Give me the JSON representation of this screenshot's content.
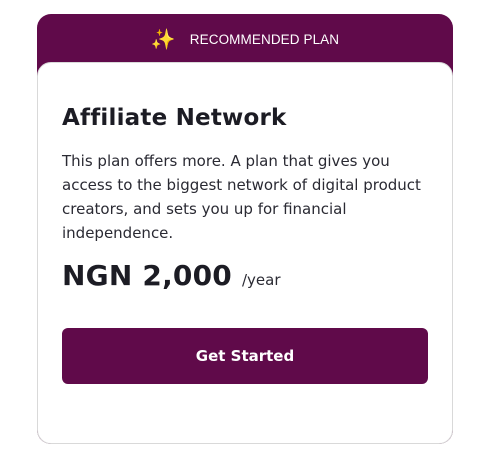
{
  "ribbon": {
    "icon": "sparkles-icon",
    "label": "RECOMMENDED PLAN"
  },
  "plan": {
    "name": "Affiliate Network",
    "description": "This plan offers more. A plan that gives you access to the biggest network of digital product creators, and sets you up for financial independence.",
    "price": "NGN 2,000",
    "period": "/year",
    "cta_label": "Get Started"
  },
  "colors": {
    "accent": "#600a4a",
    "text": "#1c1c24",
    "sparkle": "#f2c230"
  }
}
